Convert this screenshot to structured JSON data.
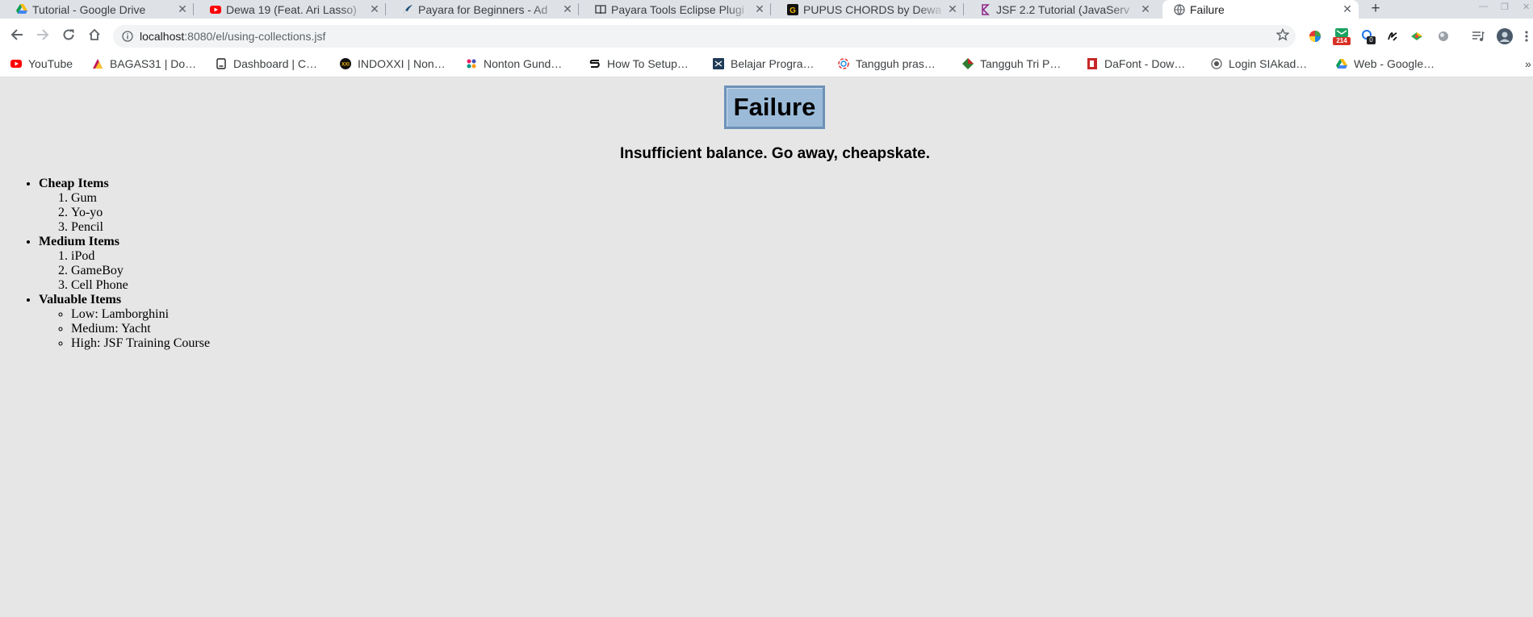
{
  "tabs": [
    {
      "title": "Tutorial - Google Drive",
      "icon": "google-drive-icon"
    },
    {
      "title": "Dewa 19 (Feat. Ari Lasso)",
      "icon": "youtube-icon"
    },
    {
      "title": "Payara for Beginners - Ad",
      "icon": "payara-icon"
    },
    {
      "title": "Payara Tools Eclipse Plugi",
      "icon": "book-icon"
    },
    {
      "title": "PUPUS CHORDS by Dewa",
      "icon": "chords-icon"
    },
    {
      "title": "JSF 2.2 Tutorial (JavaServ",
      "icon": "jsf-icon"
    },
    {
      "title": "Failure",
      "icon": "globe-icon"
    }
  ],
  "address": {
    "host": "localhost",
    "path": ":8080/el/using-collections.jsf"
  },
  "extension_badges": {
    "mail_count": "214",
    "reader_count": "0"
  },
  "bookmarks": [
    {
      "label": "YouTube",
      "icon": "youtube-icon"
    },
    {
      "label": "BAGAS31 | Do…",
      "icon": "bagas-icon"
    },
    {
      "label": "Dashboard | C…",
      "icon": "dashboard-icon"
    },
    {
      "label": "INDOXXI | Non…",
      "icon": "indoxxi-icon"
    },
    {
      "label": "Nonton Gund…",
      "icon": "nonton-icon"
    },
    {
      "label": "How To Setup…",
      "icon": "howto-icon"
    },
    {
      "label": "Belajar Progra…",
      "icon": "belajar-icon"
    },
    {
      "label": "Tangguh pras…",
      "icon": "tangguh-icon"
    },
    {
      "label": "Tangguh Tri P…",
      "icon": "tangguh-tri-icon"
    },
    {
      "label": "DaFont - Dow…",
      "icon": "dafont-icon"
    },
    {
      "label": "Login SIAkad…",
      "icon": "siakad-icon"
    },
    {
      "label": "Web - Google…",
      "icon": "google-drive-icon"
    }
  ],
  "page": {
    "title": "Failure",
    "message": "Insufficient balance. Go away, cheapskate.",
    "groups": [
      {
        "label": "Cheap Items",
        "ordered": true,
        "items": [
          "Gum",
          "Yo-yo",
          "Pencil"
        ]
      },
      {
        "label": "Medium Items",
        "ordered": true,
        "items": [
          "iPod",
          "GameBoy",
          "Cell Phone"
        ]
      },
      {
        "label": "Valuable Items",
        "ordered": false,
        "items": [
          "Low: Lamborghini",
          "Medium: Yacht",
          "High: JSF Training Course"
        ]
      }
    ]
  },
  "colors": {
    "page_background": "#e6e6e6",
    "title_fill": "#9bbbd9",
    "title_border": "#6d91b8"
  }
}
